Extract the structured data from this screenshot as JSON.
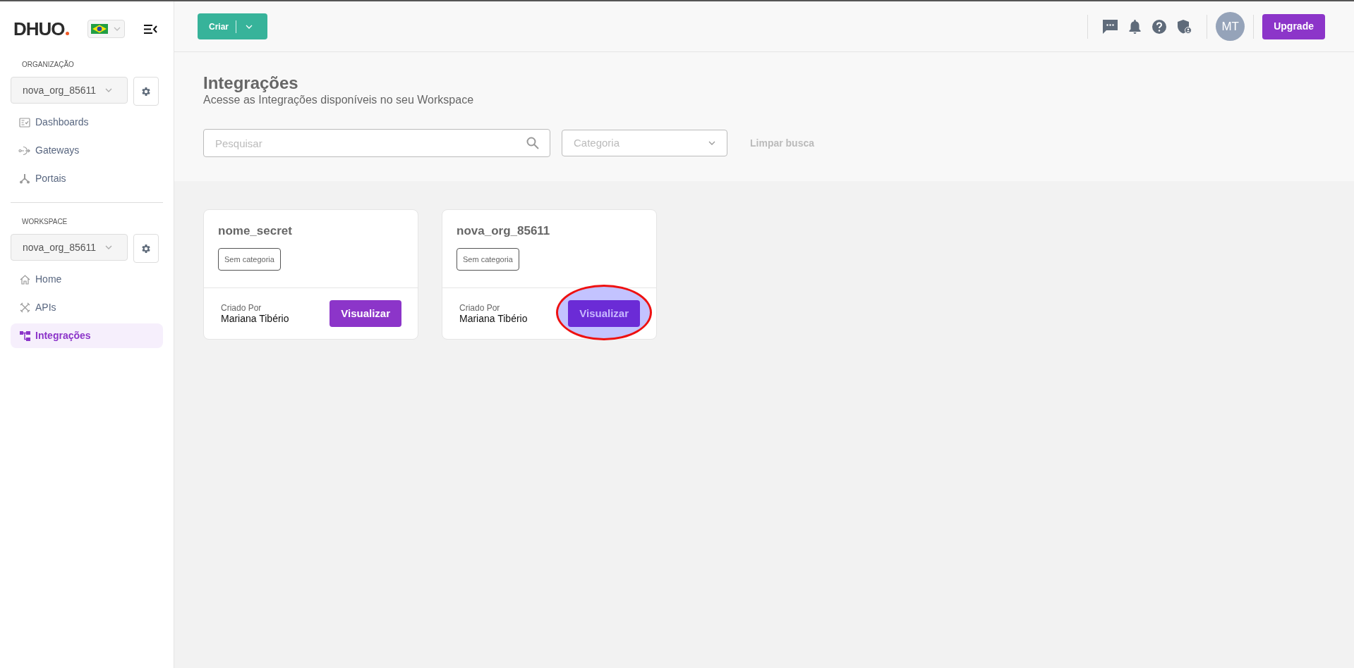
{
  "sidebar": {
    "logo": "DHUO",
    "sections": [
      {
        "label": "ORGANIZAÇÃO",
        "select": "nova_org_85611",
        "items": [
          {
            "label": "Dashboards",
            "kind": "dashboard",
            "selected": false
          },
          {
            "label": "Gateways",
            "kind": "gateway",
            "selected": false
          },
          {
            "label": "Portais",
            "kind": "portal",
            "selected": false
          }
        ]
      },
      {
        "label": "WORKSPACE",
        "select": "nova_org_85611",
        "items": [
          {
            "label": "Home",
            "kind": "home",
            "selected": false
          },
          {
            "label": "APIs",
            "kind": "tools",
            "selected": false
          },
          {
            "label": "Integrações",
            "kind": "integration",
            "selected": true
          }
        ]
      }
    ]
  },
  "header": {
    "create_button": "Criar",
    "avatar": "MT",
    "upgrade_button": "Upgrade"
  },
  "page": {
    "title": "Integrações",
    "subtitle": "Acesse as Integrações disponíveis no seu Workspace",
    "search": {
      "placeholder": "Pesquisar"
    },
    "category": {
      "placeholder": "Categoria"
    },
    "clear_button": "Limpar busca"
  },
  "cards": [
    {
      "title": "nome_secret",
      "category": "Sem categoria",
      "created_by_label": "Criado Por",
      "creator": "Mariana Tibério",
      "button": "Visualizar",
      "highlighted": false
    },
    {
      "title": "nova_org_85611",
      "category": "Sem categoria",
      "created_by_label": "Criado Por",
      "creator": "Mariana Tibério",
      "button": "Visualizar",
      "highlighted": true
    }
  ]
}
